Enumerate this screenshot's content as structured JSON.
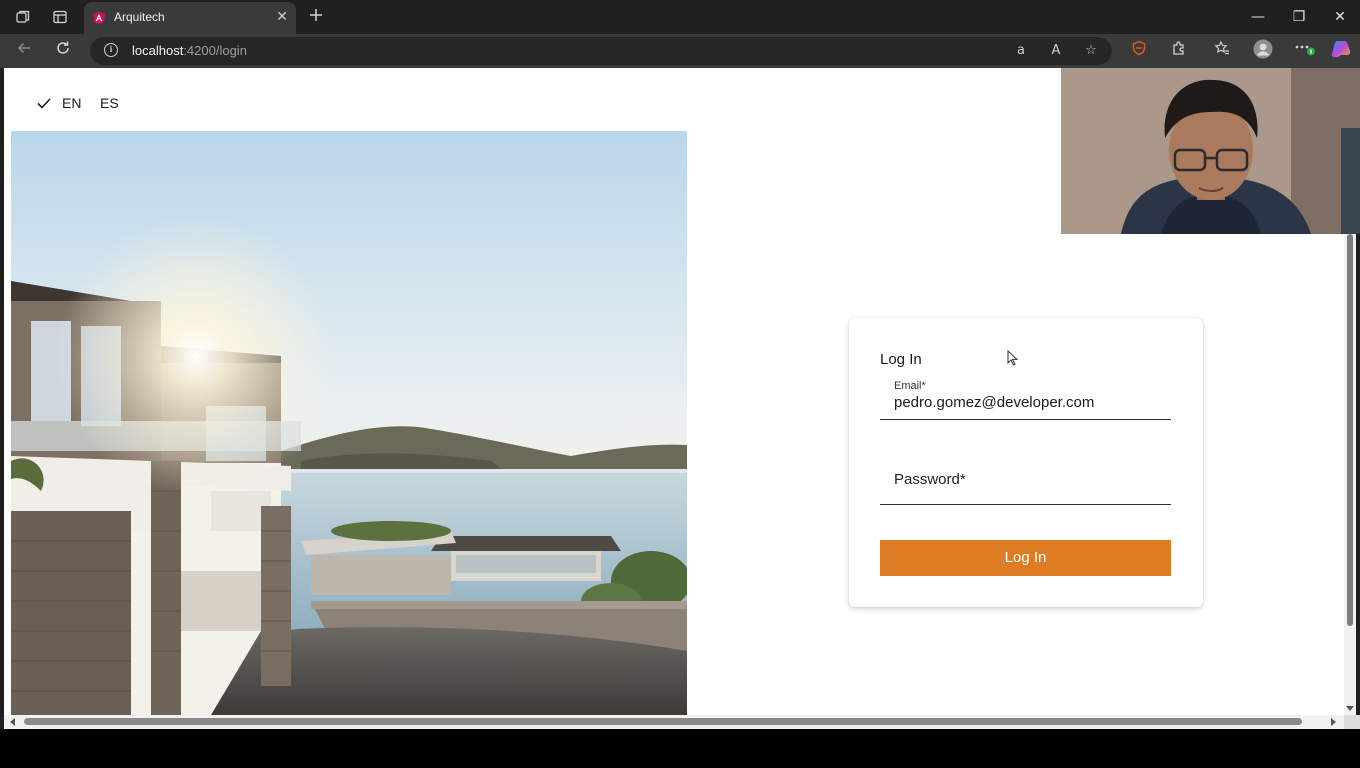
{
  "browser": {
    "tab_title": "Arquitech",
    "url_host": "localhost",
    "url_path": ":4200/login",
    "icons": {
      "workspaces": "workspaces-icon",
      "tab_actions": "tab-actions-icon",
      "close_tab": "close-icon",
      "new_tab": "plus-icon",
      "back": "back-arrow-icon",
      "refresh": "refresh-icon",
      "site_info": "info-icon",
      "read_aloud": "read-aloud-icon",
      "translate": "translate-icon",
      "favorite": "star-icon",
      "extension_brave": "shield-extension-icon",
      "extensions": "puzzle-icon",
      "favorites": "favorites-icon",
      "profile": "profile-avatar-icon",
      "more": "more-icon",
      "copilot": "copilot-icon"
    },
    "window": {
      "minimize": "—",
      "restore": "❐",
      "close": "✕"
    }
  },
  "page": {
    "languages": [
      {
        "code": "EN",
        "selected": true
      },
      {
        "code": "ES",
        "selected": false
      }
    ],
    "login": {
      "title": "Log In",
      "email_label": "Email*",
      "email_value": "pedro.gomez@developer.com",
      "password_label": "Password*",
      "submit_label": "Log In"
    }
  },
  "colors": {
    "accent": "#de7c24",
    "tab_bg": "#3a3a3a",
    "chrome_bg": "#202020"
  }
}
